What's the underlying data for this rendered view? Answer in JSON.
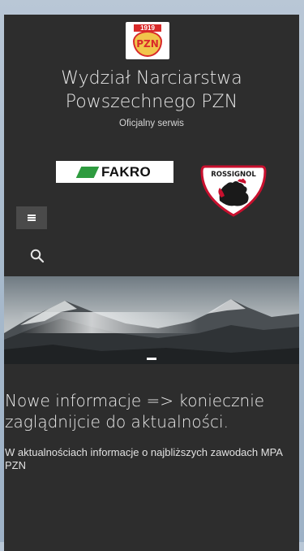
{
  "site": {
    "logo_year": "1919",
    "logo_text": "PZN",
    "title": "Wydział Narciarstwa Powszechnego PZN",
    "tagline": "Oficjalny serwis"
  },
  "sponsors": {
    "fakro": "FAKRO",
    "rossignol": "ROSSIGNOL"
  },
  "nav": {
    "menu_icon": "hamburger-icon",
    "search_icon": "search-icon"
  },
  "hero": {
    "slide_count": 1,
    "active_slide": 1
  },
  "post": {
    "headline": "Nowe informacje => koniecznie zaglądnijcie do aktualności.",
    "excerpt": "W aktualnościach informacje o najbliższych zawodach MPA PZN"
  },
  "colors": {
    "panel": "#2d2d2d",
    "accent_red": "#d92a2a",
    "fakro_green": "#2e9b3f"
  }
}
